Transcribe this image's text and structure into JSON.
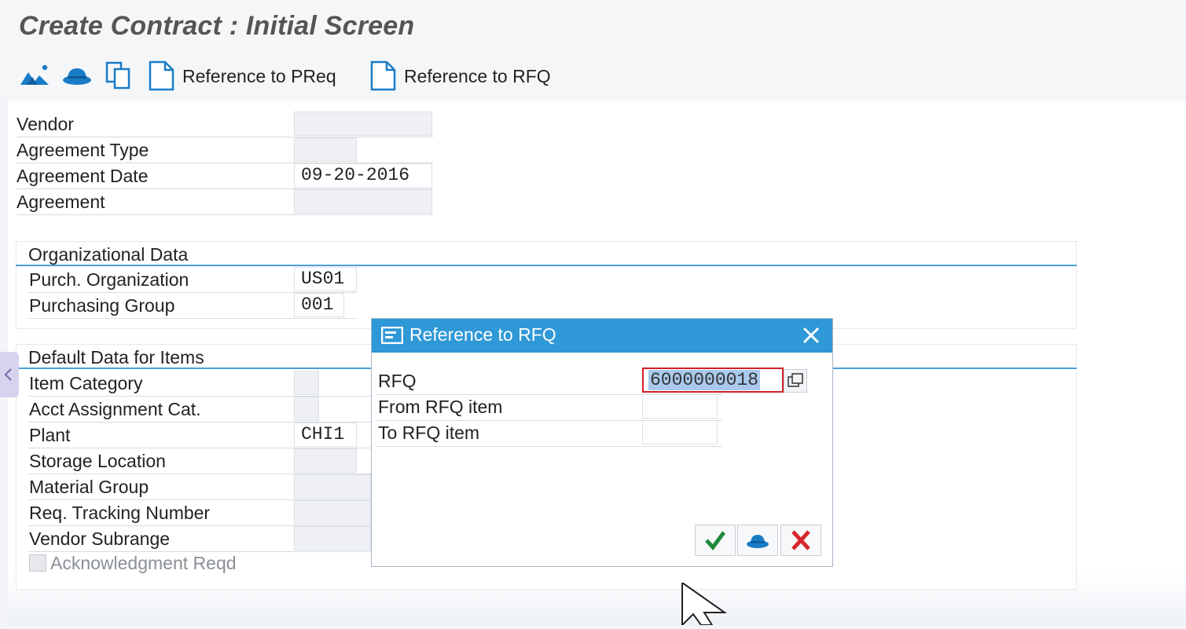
{
  "page_title": "Create Contract : Initial Screen",
  "toolbar": {
    "icons": [
      "mountains-icon",
      "hat-icon",
      "copy-icon",
      "document-icon"
    ],
    "ref_preq_label": "Reference to PReq",
    "ref_rfq_label": "Reference to RFQ"
  },
  "header_fields": {
    "vendor_label": "Vendor",
    "vendor_value": "",
    "agreement_type_label": "Agreement Type",
    "agreement_type_value": "",
    "agreement_date_label": "Agreement Date",
    "agreement_date_value": "09-20-2016",
    "agreement_label": "Agreement",
    "agreement_value": ""
  },
  "org_data": {
    "title": "Organizational Data",
    "purch_org_label": "Purch. Organization",
    "purch_org_value": "US01",
    "purch_group_label": "Purchasing Group",
    "purch_group_value": "001"
  },
  "default_data": {
    "title": "Default Data for Items",
    "item_category_label": "Item Category",
    "acct_assignment_label": "Acct Assignment Cat.",
    "plant_label": "Plant",
    "plant_value": "CHI1",
    "storage_location_label": "Storage Location",
    "material_group_label": "Material Group",
    "req_tracking_label": "Req. Tracking Number",
    "vendor_subrange_label": "Vendor Subrange",
    "ack_reqd_label": "Acknowledgment Reqd",
    "ack_reqd_checked": false
  },
  "dialog": {
    "title": "Reference to RFQ",
    "rfq_label": "RFQ",
    "rfq_value": "6000000018",
    "from_item_label": "From RFQ item",
    "from_item_value": "",
    "to_item_label": "To RFQ item",
    "to_item_value": "",
    "buttons": [
      "confirm-check-icon",
      "hat-icon",
      "cancel-x-icon"
    ]
  },
  "colors": {
    "accent": "#2f98d6",
    "group_line": "#4a9fd8",
    "confirm_green": "#1f8a3a",
    "cancel_red": "#d8262b"
  }
}
